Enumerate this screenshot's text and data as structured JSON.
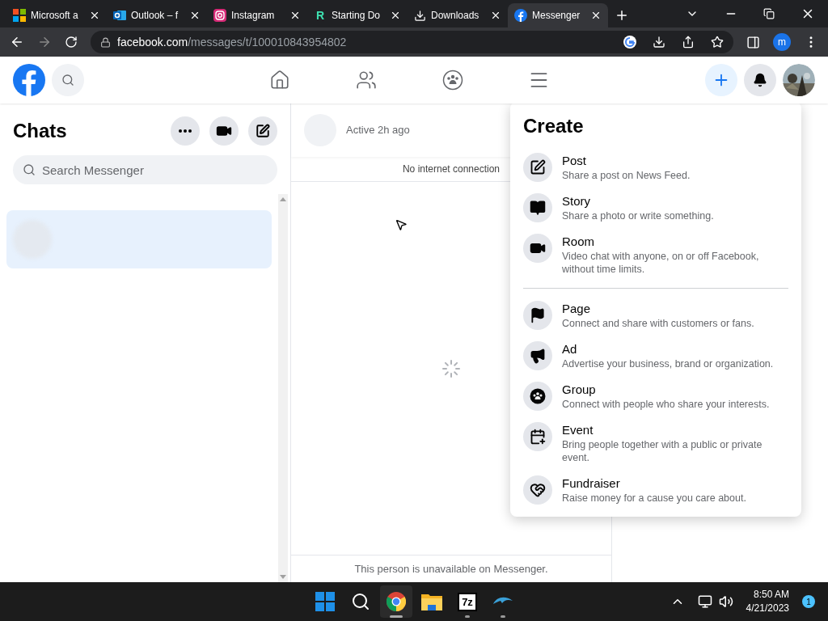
{
  "browser": {
    "tabs": [
      {
        "title": "Microsoft a",
        "kind": "microsoft",
        "selected": false
      },
      {
        "title": "Outlook – f",
        "kind": "outlook",
        "selected": false
      },
      {
        "title": "Instagram",
        "kind": "instagram",
        "selected": false
      },
      {
        "title": "Starting Do",
        "kind": "letter",
        "letter": "R",
        "selected": false
      },
      {
        "title": "Downloads",
        "kind": "download",
        "selected": false
      },
      {
        "title": "Messenger",
        "kind": "facebook",
        "selected": true
      }
    ],
    "url_host": "facebook.com",
    "url_path": "/messages/t/100010843954802",
    "profile_initial": "m"
  },
  "header": {
    "nav": [
      {
        "kind": "home",
        "selected": false
      },
      {
        "kind": "friends",
        "selected": false
      },
      {
        "kind": "groups",
        "selected": false
      },
      {
        "kind": "menu",
        "selected": false
      }
    ],
    "actions": [
      {
        "kind": "create",
        "selected": true
      },
      {
        "kind": "notifications",
        "selected": false
      }
    ]
  },
  "chats": {
    "title": "Chats",
    "search_placeholder": "Search Messenger",
    "list": [
      {
        "selected": true
      }
    ]
  },
  "conversation": {
    "status": "Active 2h ago",
    "banner": "No internet connection",
    "footer": "This person is unavailable on Messenger."
  },
  "create_menu": {
    "title": "Create",
    "sections": [
      [
        {
          "kind": "post",
          "title": "Post",
          "description": "Share a post on News Feed."
        },
        {
          "kind": "story",
          "title": "Story",
          "description": "Share a photo or write something."
        },
        {
          "kind": "room",
          "title": "Room",
          "description": "Video chat with anyone, on or off Facebook, without time limits."
        }
      ],
      [
        {
          "kind": "page",
          "title": "Page",
          "description": "Connect and share with customers or fans."
        },
        {
          "kind": "ad",
          "title": "Ad",
          "description": "Advertise your business, brand or organization."
        },
        {
          "kind": "group",
          "title": "Group",
          "description": "Connect with people who share your interests."
        },
        {
          "kind": "event",
          "title": "Event",
          "description": "Bring people together with a public or private event."
        },
        {
          "kind": "fundraiser",
          "title": "Fundraiser",
          "description": "Raise money for a cause you care about."
        }
      ]
    ]
  },
  "taskbar": {
    "apps": [
      {
        "kind": "start",
        "selected": false,
        "running": false
      },
      {
        "kind": "search",
        "selected": false,
        "running": false
      },
      {
        "kind": "chrome",
        "selected": true,
        "running": true
      },
      {
        "kind": "explorer",
        "selected": false,
        "running": false
      },
      {
        "kind": "archiver",
        "label": "7z",
        "selected": false,
        "running": true
      },
      {
        "kind": "dolphin",
        "selected": false,
        "running": true
      }
    ],
    "time": "8:50 AM",
    "date": "4/21/2023",
    "notification_count": "1"
  }
}
